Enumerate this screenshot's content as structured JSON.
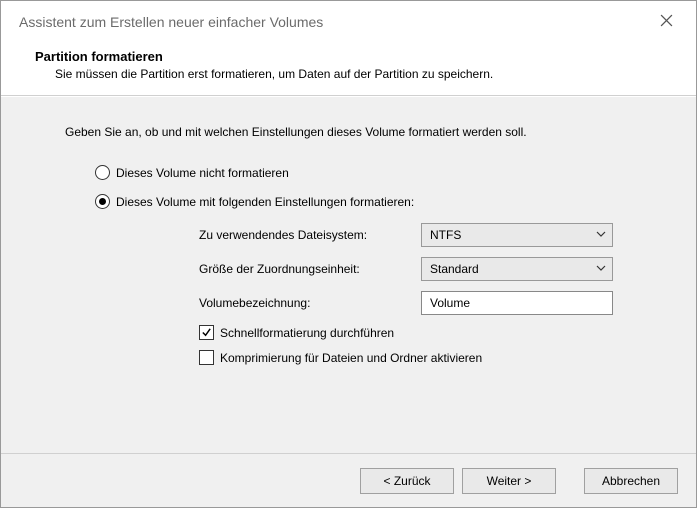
{
  "window": {
    "title": "Assistent zum Erstellen neuer einfacher Volumes"
  },
  "header": {
    "title": "Partition formatieren",
    "subtitle": "Sie müssen die Partition erst formatieren, um Daten auf der Partition zu speichern."
  },
  "instruction": "Geben Sie an, ob und mit welchen Einstellungen dieses Volume formatiert werden soll.",
  "radios": {
    "option_no_format": "Dieses Volume nicht formatieren",
    "option_format_with": "Dieses Volume mit folgenden Einstellungen formatieren:",
    "selected": "format_with"
  },
  "form": {
    "filesystem_label": "Zu verwendendes Dateisystem:",
    "filesystem_value": "NTFS",
    "allocation_label": "Größe der Zuordnungseinheit:",
    "allocation_value": "Standard",
    "volumelabel_label": "Volumebezeichnung:",
    "volumelabel_value": "Volume"
  },
  "checkboxes": {
    "quick_format_label": "Schnellformatierung durchführen",
    "quick_format_checked": true,
    "compression_label": "Komprimierung für Dateien und Ordner aktivieren",
    "compression_checked": false
  },
  "buttons": {
    "back": "< Zurück",
    "next": "Weiter >",
    "cancel": "Abbrechen"
  }
}
